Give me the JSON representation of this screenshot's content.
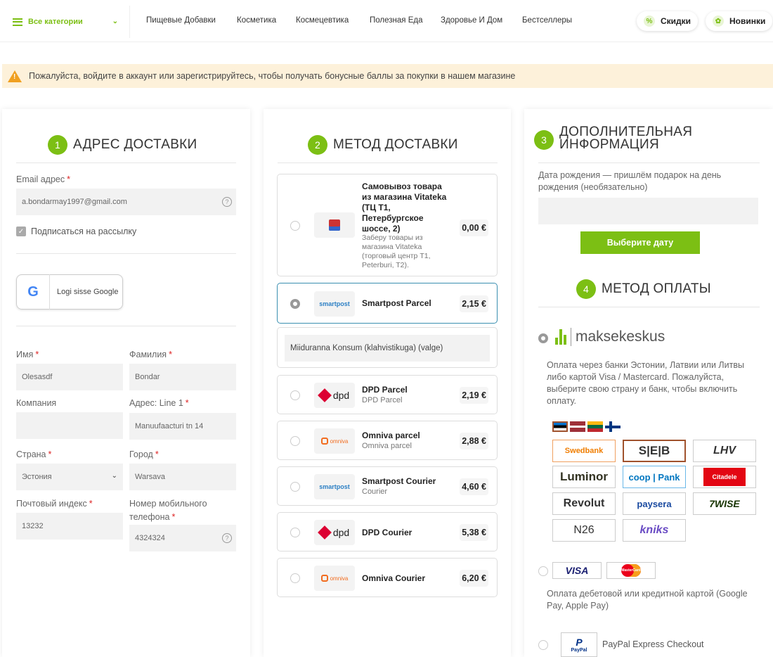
{
  "header": {
    "all_categories": "Все категории",
    "nav": [
      "Пищевые Добавки",
      "Косметика",
      "Космецевтика",
      "Полезная Еда",
      "Здоровье И Дом",
      "Бестселлеры"
    ],
    "discounts": "Скидки",
    "new_items": "Новинки"
  },
  "banner": {
    "text": "Пожалуйста, войдите в аккаунт или зарегистрируйтесь, чтобы получать бонусные баллы за покупки в нашем магазине"
  },
  "address": {
    "num": "1",
    "title": "АДРЕС ДОСТАВКИ",
    "email_label": "Email адрес",
    "email_value": "a.bondarmay1997@gmail.com",
    "subscribe": "Подписаться на рассылку",
    "google": "Logi sisse Google",
    "first_name_label": "Имя",
    "first_name_value": "Olesasdf",
    "last_name_label": "Фамилия",
    "last_name_value": "Bondar",
    "company_label": "Компания",
    "company_value": "",
    "address_label": "Адрес: Line 1",
    "address_value": "Manuufaacturi tn 14",
    "country_label": "Страна",
    "country_value": "Эстония",
    "city_label": "Город",
    "city_value": "Warsava",
    "zip_label": "Почтовый индекс",
    "zip_value": "13232",
    "phone_label_1": "Номер мобильного",
    "phone_label_2": "телефона",
    "phone_value": "4324324",
    "req": "*",
    "help": "?"
  },
  "shipping": {
    "num": "2",
    "title": "МЕТОД ДОСТАВКИ",
    "methods": [
      {
        "name": "Самовывоз товара из магазина Vitateka (ТЦ T1, Петербургское шоссе, 2)",
        "sub": "Заберу товары из магазина Vitateka (торговый центр T1, Peterburi, T2).",
        "price": "0,00 €",
        "logo": "store"
      },
      {
        "name": "Smartpost Parcel",
        "sub": "",
        "price": "2,15 €",
        "logo": "smartpost"
      },
      {
        "name": "DPD Parcel",
        "sub": "DPD Parcel",
        "price": "2,19 €",
        "logo": "dpd"
      },
      {
        "name": "Omniva parcel",
        "sub": "Omniva parcel",
        "price": "2,88 €",
        "logo": "omniva"
      },
      {
        "name": "Smartpost Courier",
        "sub": "Courier",
        "price": "4,60 €",
        "logo": "smartpost"
      },
      {
        "name": "DPD Courier",
        "sub": "",
        "price": "5,38 €",
        "logo": "dpd"
      },
      {
        "name": "Omniva Courier",
        "sub": "",
        "price": "6,20 €",
        "logo": "omniva"
      }
    ],
    "pickup_point": "Miiduranna Konsum (klahvistikuga) (valge)",
    "logo_smartpost": "smartpost",
    "logo_dpd": "dpd",
    "logo_omniva": "omniva"
  },
  "extra": {
    "num": "3",
    "title_1": "ДОПОЛНИТЕЛЬНАЯ",
    "title_2": "ИНФОРМАЦИЯ",
    "dob_label": "Дата рождения — пришлём подарок на день рождения (необязательно)",
    "dob_value": "",
    "date_button": "Выберите дату"
  },
  "payment": {
    "num": "4",
    "title": "МЕТОД ОПЛАТЫ",
    "provider": "maksekeskus",
    "provider_desc": "Оплата через банки Эстонии, Латвии или Литвы либо картой Visa / Mastercard. Пожалуйста, выберите свою страну и банк, чтобы включить оплату.",
    "banks": [
      "Swedbank",
      "S|E|B",
      "LHV",
      "Luminor",
      "coop | Pank",
      "Citadele",
      "Revolut",
      "paysera",
      "7WISE",
      "N26",
      "kniks"
    ],
    "visa": "VISA",
    "mastercard": "MasterCard",
    "card_desc": "Оплата дебетовой или кредитной картой (Google Pay, Apple Pay)",
    "paypal": "PayPal Express Checkout",
    "paypal_logo": "PayPal"
  },
  "colors": {
    "accent": "#7cbf14",
    "banner_bg": "#fdf1da",
    "warning": "#f0a020"
  }
}
